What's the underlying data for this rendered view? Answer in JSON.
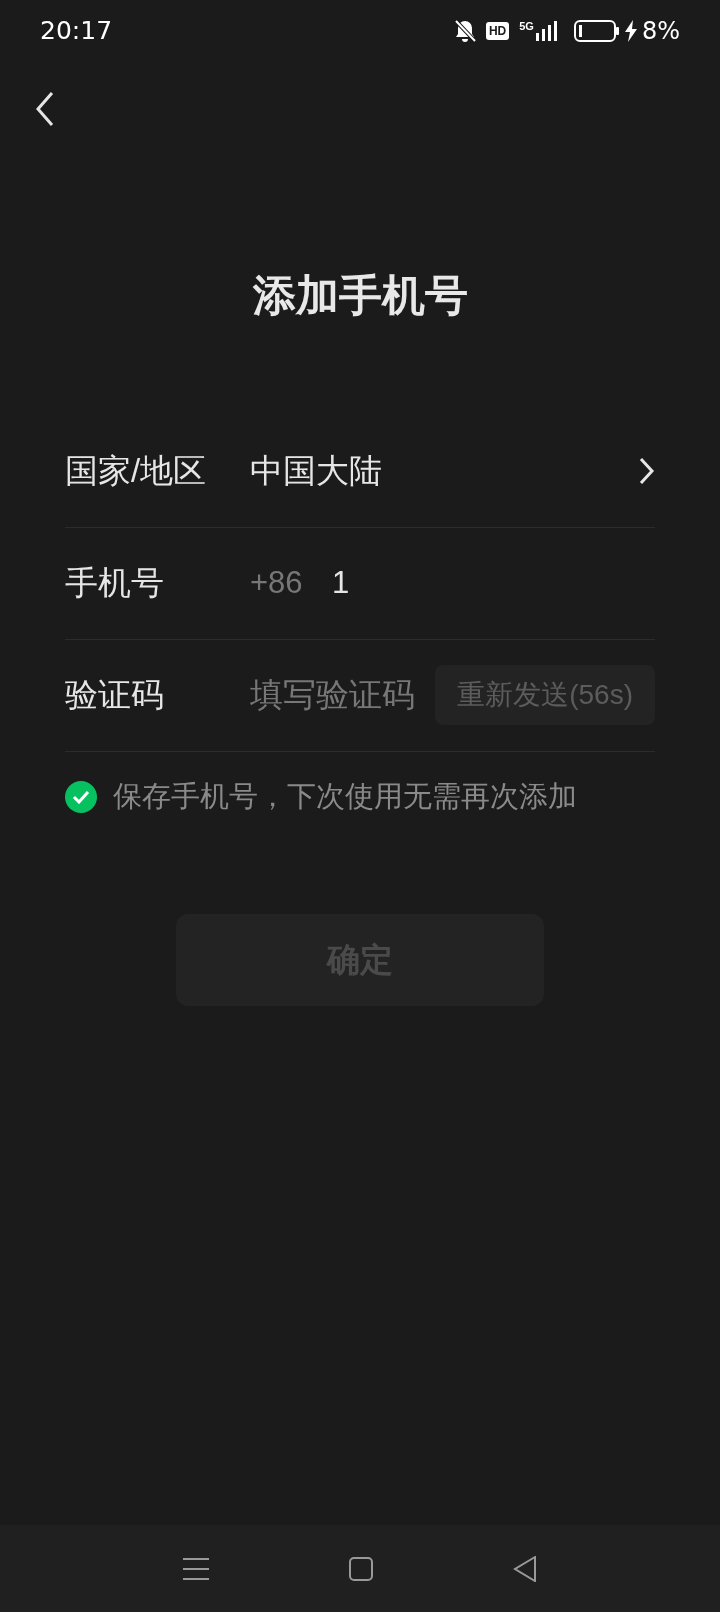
{
  "status_bar": {
    "time": "20:17",
    "hd": "HD",
    "network": "5G",
    "battery": "8%"
  },
  "title": "添加手机号",
  "form": {
    "rows": [
      {
        "kind": "select",
        "label": "国家/地区",
        "value": "中国大陆"
      },
      {
        "kind": "phone",
        "label": "手机号",
        "prefix": "+86",
        "value": "1"
      },
      {
        "kind": "code",
        "label": "验证码",
        "placeholder": "填写验证码",
        "button": {
          "label": "重新发送(56s)",
          "disabled": true
        }
      }
    ]
  },
  "save_option": {
    "label": "保存手机号，下次使用无需再次添加",
    "checked": true
  },
  "confirm": {
    "label": "确定",
    "disabled": true
  }
}
